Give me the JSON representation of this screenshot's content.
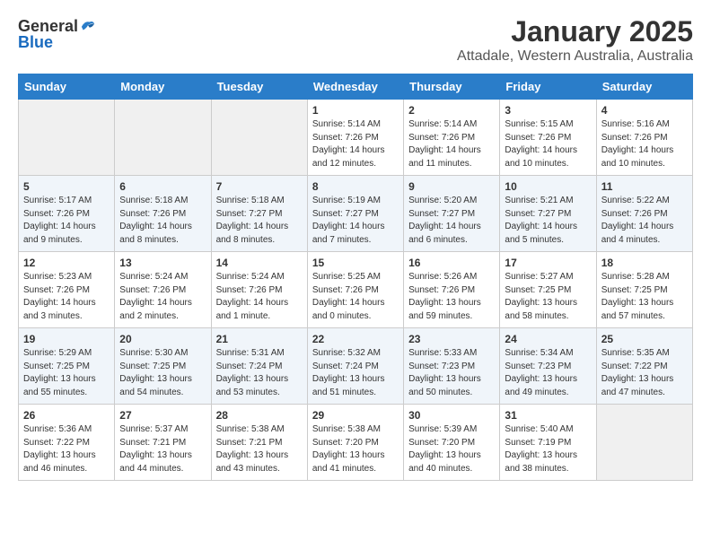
{
  "header": {
    "logo_general": "General",
    "logo_blue": "Blue",
    "title": "January 2025",
    "subtitle": "Attadale, Western Australia, Australia"
  },
  "calendar": {
    "days_of_week": [
      "Sunday",
      "Monday",
      "Tuesday",
      "Wednesday",
      "Thursday",
      "Friday",
      "Saturday"
    ],
    "weeks": [
      [
        {
          "day": "",
          "info": ""
        },
        {
          "day": "",
          "info": ""
        },
        {
          "day": "",
          "info": ""
        },
        {
          "day": "1",
          "info": "Sunrise: 5:14 AM\nSunset: 7:26 PM\nDaylight: 14 hours\nand 12 minutes."
        },
        {
          "day": "2",
          "info": "Sunrise: 5:14 AM\nSunset: 7:26 PM\nDaylight: 14 hours\nand 11 minutes."
        },
        {
          "day": "3",
          "info": "Sunrise: 5:15 AM\nSunset: 7:26 PM\nDaylight: 14 hours\nand 10 minutes."
        },
        {
          "day": "4",
          "info": "Sunrise: 5:16 AM\nSunset: 7:26 PM\nDaylight: 14 hours\nand 10 minutes."
        }
      ],
      [
        {
          "day": "5",
          "info": "Sunrise: 5:17 AM\nSunset: 7:26 PM\nDaylight: 14 hours\nand 9 minutes."
        },
        {
          "day": "6",
          "info": "Sunrise: 5:18 AM\nSunset: 7:26 PM\nDaylight: 14 hours\nand 8 minutes."
        },
        {
          "day": "7",
          "info": "Sunrise: 5:18 AM\nSunset: 7:27 PM\nDaylight: 14 hours\nand 8 minutes."
        },
        {
          "day": "8",
          "info": "Sunrise: 5:19 AM\nSunset: 7:27 PM\nDaylight: 14 hours\nand 7 minutes."
        },
        {
          "day": "9",
          "info": "Sunrise: 5:20 AM\nSunset: 7:27 PM\nDaylight: 14 hours\nand 6 minutes."
        },
        {
          "day": "10",
          "info": "Sunrise: 5:21 AM\nSunset: 7:27 PM\nDaylight: 14 hours\nand 5 minutes."
        },
        {
          "day": "11",
          "info": "Sunrise: 5:22 AM\nSunset: 7:26 PM\nDaylight: 14 hours\nand 4 minutes."
        }
      ],
      [
        {
          "day": "12",
          "info": "Sunrise: 5:23 AM\nSunset: 7:26 PM\nDaylight: 14 hours\nand 3 minutes."
        },
        {
          "day": "13",
          "info": "Sunrise: 5:24 AM\nSunset: 7:26 PM\nDaylight: 14 hours\nand 2 minutes."
        },
        {
          "day": "14",
          "info": "Sunrise: 5:24 AM\nSunset: 7:26 PM\nDaylight: 14 hours\nand 1 minute."
        },
        {
          "day": "15",
          "info": "Sunrise: 5:25 AM\nSunset: 7:26 PM\nDaylight: 14 hours\nand 0 minutes."
        },
        {
          "day": "16",
          "info": "Sunrise: 5:26 AM\nSunset: 7:26 PM\nDaylight: 13 hours\nand 59 minutes."
        },
        {
          "day": "17",
          "info": "Sunrise: 5:27 AM\nSunset: 7:25 PM\nDaylight: 13 hours\nand 58 minutes."
        },
        {
          "day": "18",
          "info": "Sunrise: 5:28 AM\nSunset: 7:25 PM\nDaylight: 13 hours\nand 57 minutes."
        }
      ],
      [
        {
          "day": "19",
          "info": "Sunrise: 5:29 AM\nSunset: 7:25 PM\nDaylight: 13 hours\nand 55 minutes."
        },
        {
          "day": "20",
          "info": "Sunrise: 5:30 AM\nSunset: 7:25 PM\nDaylight: 13 hours\nand 54 minutes."
        },
        {
          "day": "21",
          "info": "Sunrise: 5:31 AM\nSunset: 7:24 PM\nDaylight: 13 hours\nand 53 minutes."
        },
        {
          "day": "22",
          "info": "Sunrise: 5:32 AM\nSunset: 7:24 PM\nDaylight: 13 hours\nand 51 minutes."
        },
        {
          "day": "23",
          "info": "Sunrise: 5:33 AM\nSunset: 7:23 PM\nDaylight: 13 hours\nand 50 minutes."
        },
        {
          "day": "24",
          "info": "Sunrise: 5:34 AM\nSunset: 7:23 PM\nDaylight: 13 hours\nand 49 minutes."
        },
        {
          "day": "25",
          "info": "Sunrise: 5:35 AM\nSunset: 7:22 PM\nDaylight: 13 hours\nand 47 minutes."
        }
      ],
      [
        {
          "day": "26",
          "info": "Sunrise: 5:36 AM\nSunset: 7:22 PM\nDaylight: 13 hours\nand 46 minutes."
        },
        {
          "day": "27",
          "info": "Sunrise: 5:37 AM\nSunset: 7:21 PM\nDaylight: 13 hours\nand 44 minutes."
        },
        {
          "day": "28",
          "info": "Sunrise: 5:38 AM\nSunset: 7:21 PM\nDaylight: 13 hours\nand 43 minutes."
        },
        {
          "day": "29",
          "info": "Sunrise: 5:38 AM\nSunset: 7:20 PM\nDaylight: 13 hours\nand 41 minutes."
        },
        {
          "day": "30",
          "info": "Sunrise: 5:39 AM\nSunset: 7:20 PM\nDaylight: 13 hours\nand 40 minutes."
        },
        {
          "day": "31",
          "info": "Sunrise: 5:40 AM\nSunset: 7:19 PM\nDaylight: 13 hours\nand 38 minutes."
        },
        {
          "day": "",
          "info": ""
        }
      ]
    ]
  }
}
